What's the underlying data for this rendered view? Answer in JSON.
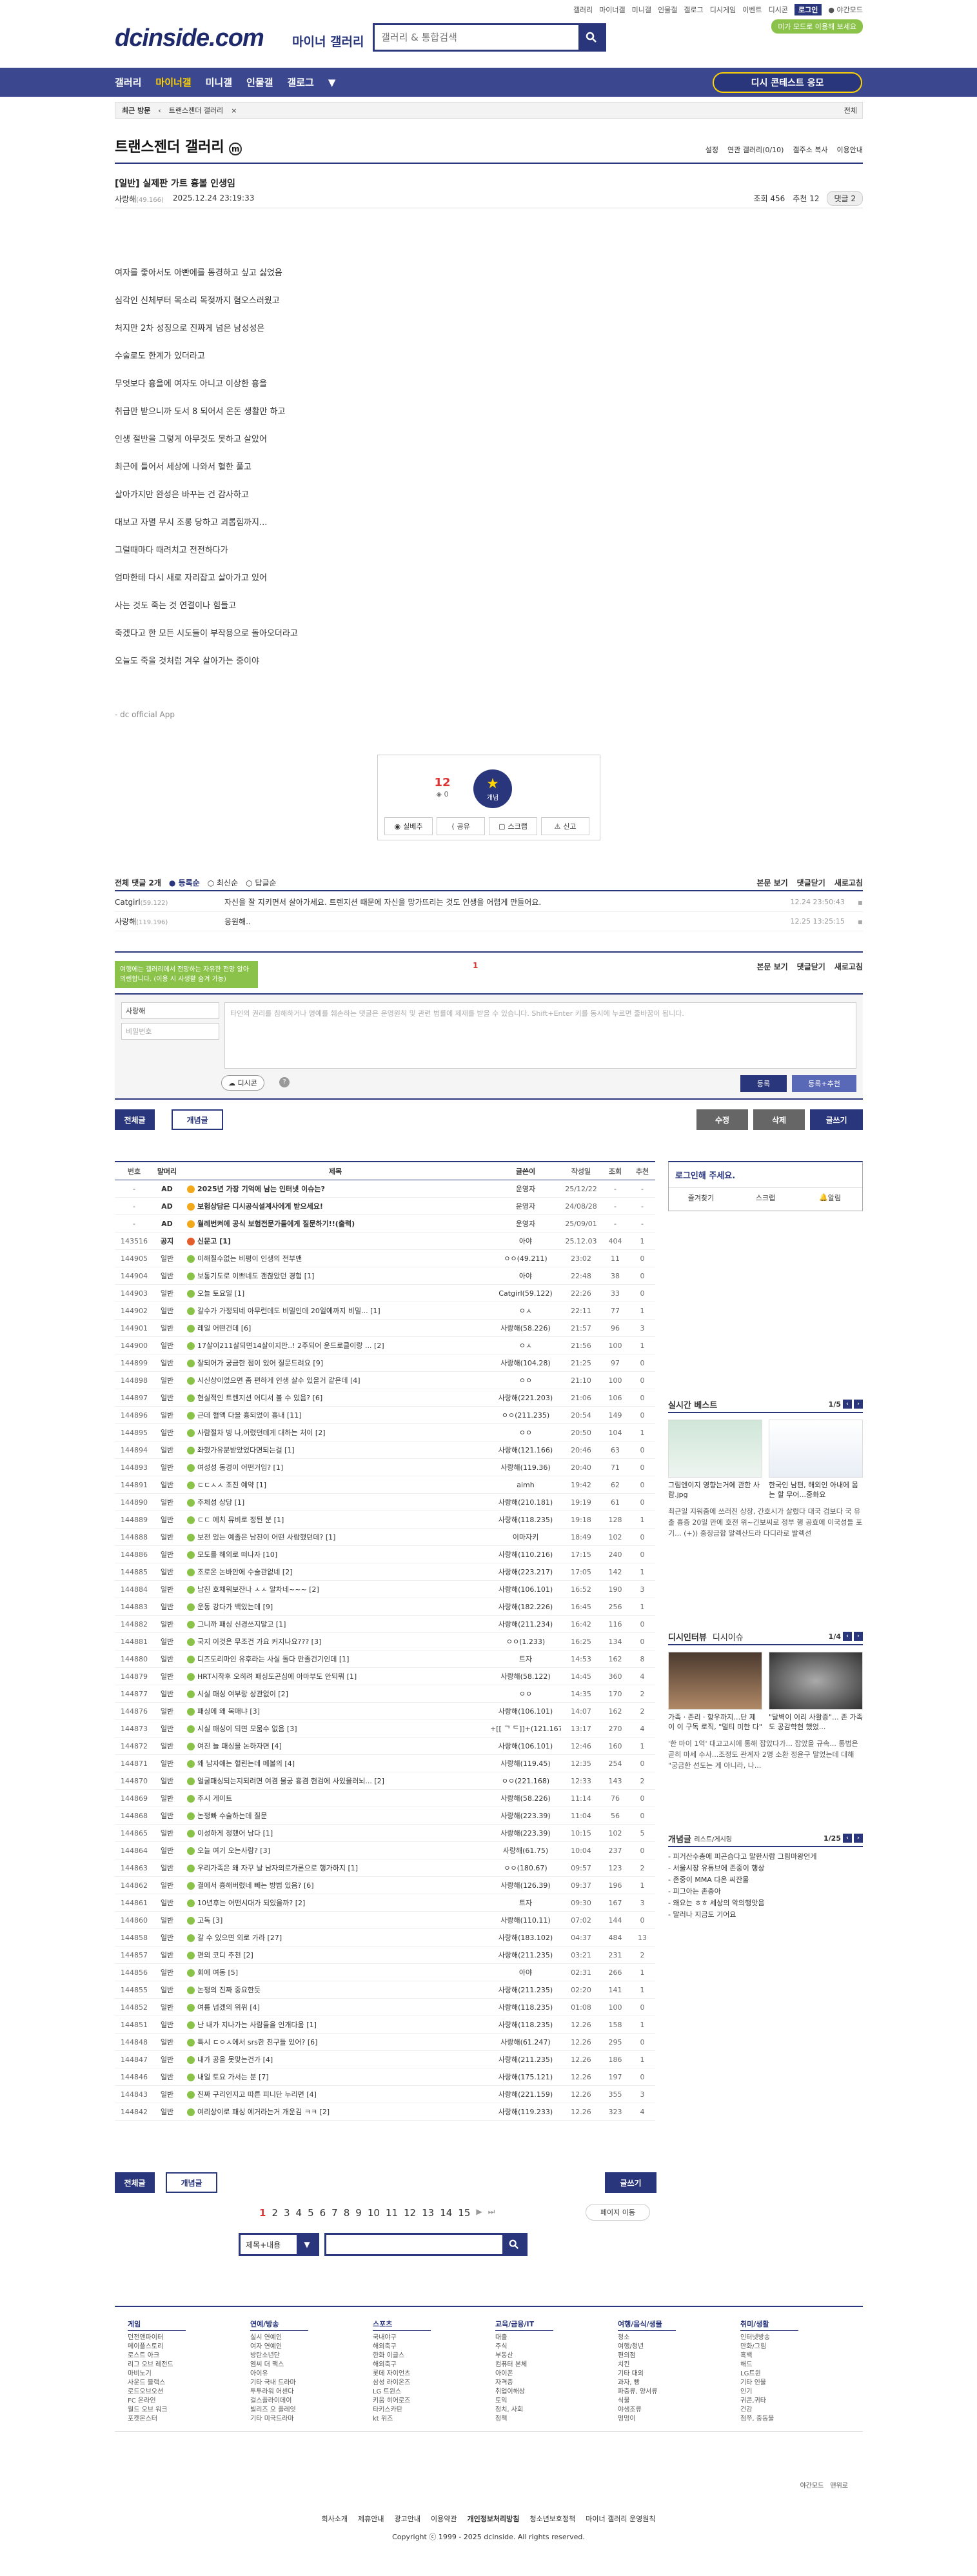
{
  "header": {
    "logo": "dcinside.com",
    "logo_sub": "마이너 갤러리",
    "search_placeholder": "갤러리 & 통합검색",
    "top_links": [
      "갤러리",
      "마이너갤",
      "미니갤",
      "인물갤",
      "갤로그",
      "디시게임",
      "이벤트",
      "디시콘"
    ],
    "login": "로그인",
    "night": "야간모드",
    "promo": "미가 모드로 이용해 보세요"
  },
  "gnb": {
    "items": [
      "갤러리",
      "마이너갤",
      "미니갤",
      "인물갤",
      "갤로그"
    ],
    "active": "마이너갤",
    "cta": "디시 콘테스트 응모"
  },
  "breadcrumb": {
    "recent": "최근 방문",
    "gallery": "트랜스젠더 갤러리",
    "all": "전체"
  },
  "gallery": {
    "title": "트랜스젠더 갤러리",
    "badge": "m",
    "tools": [
      "설정",
      "연관 갤러리(0/10)",
      "갤주소 복사",
      "이용안내"
    ]
  },
  "post": {
    "title": "[일반] 실제판 가트 흉볼 인생임",
    "author": "사랑해",
    "author_ip": "(49.166)",
    "date": "2025.12.24 23:19:33",
    "views": "조회 456",
    "recommend": "추천 12",
    "comments": "댓글 2",
    "lines": [
      "여자를 좋아서도 아빤에를 동경하고 싶고 싫었음",
      "심각인 신체부터 목소리 목젖까지 혐오스러웠고",
      "처지만 2차 성징으로 진짜게 넘은 남성성은",
      "수술로도 한계가 있더라고",
      "무엇보다 흉을에 여자도 아니고 이상한 흉을",
      "취급만 받으니까 도서 8 되어서 온돈 생활만 하고",
      "인생 절반을 그렇게 아무것도 못하고 살았어",
      "최근에 들어서 세상에 나와서 혈한 풀고",
      "살아가지만 완성은 바꾸는 건 감사하고",
      "대보고 자멸 무시 조롱 당하고 괴롭힘까지...",
      "그럴때마다 때려치고 전전하다가",
      "엄마한테 다시 새로 자리잡고 살아가고 있어",
      "사는 것도 죽는 것 연결이나 힘들고",
      "죽겠다고 한 모든 시도들이 부작용으로 돌아오더라고",
      "오늘도 죽을 것처럼 겨우 살아가는 중이야"
    ],
    "app_sig": "- dc official App",
    "rec_count": "12",
    "fix_count": "0",
    "rec_label": "개념",
    "actions": [
      "실베추",
      "공유",
      "스크랩",
      "신고"
    ]
  },
  "comments": {
    "header": "전체 댓글 2개",
    "sort": [
      "등록순",
      "최신순",
      "답글순"
    ],
    "right": [
      "본문 보기",
      "댓글닫기",
      "새로고침"
    ],
    "items": [
      {
        "nick": "Catgirl",
        "ip": "(59.122)",
        "text": "자신을 잘 지키면서 살아가세요. 트렌지션 때문에 자신을 망가뜨리는 것도 인생을 어렵게 만들어요.",
        "date": "12.24 23:50:43"
      },
      {
        "nick": "사랑해",
        "ip": "(119.196)",
        "text": "응원해..",
        "date": "12.25 13:25:15"
      }
    ],
    "page": "1",
    "tip": "여행에는 갤러리에서 전망하는 자유한 전망 알아의렌합니다. (이용 시 사생활 숨겨 가능)",
    "nick_value": "사랑해",
    "pw_placeholder": "비밀번호",
    "ta_placeholder": "타인의 권리를 침해하거나 명예를 훼손하는 댓글은 운영원칙 및 관련 법률에 제재를 받을 수 있습니다. Shift+Enter 키를 동시에 누르면 줄바꿈이 됩니다.",
    "dccon": "디시콘",
    "submit": "등록",
    "submit2": "등록+추천"
  },
  "buttons": {
    "all": "전체글",
    "best": "개념글",
    "edit": "수정",
    "del": "삭제",
    "write": "글쓰기"
  },
  "list": {
    "headers": [
      "번호",
      "말머리",
      "제목",
      "글쓴이",
      "작성일",
      "조회",
      "추천"
    ],
    "rows": [
      [
        "-",
        "AD",
        "2025년 가장 기억에 남는 인터넷 이슈는?",
        "운영자",
        "25/12/22",
        "-",
        "-"
      ],
      [
        "-",
        "AD",
        "보험상담은 디시공식설계사에게 받으세요!",
        "운영자",
        "24/08/28",
        "-",
        "-"
      ],
      [
        "-",
        "AD",
        "월례번켜에 공식 보험전문가들에게 질문하기!!(출력)",
        "운영자",
        "25/09/01",
        "-",
        "-"
      ],
      [
        "143516",
        "공지",
        "신문고 [1]",
        "아야",
        "25.12.03",
        "404",
        "1"
      ],
      [
        "144905",
        "일반",
        "이해질수없는 비평이 인생의 전부맨",
        "ㅇㅇ(49.211)",
        "23:02",
        "11",
        "0"
      ],
      [
        "144904",
        "일반",
        "보통기도로 이쁘네도 괜찮았던 경험 [1]",
        "아야",
        "22:48",
        "38",
        "0"
      ],
      [
        "144903",
        "일반",
        "오늘 토요일 [1]",
        "Catgirl(59.122)",
        "22:26",
        "33",
        "0"
      ],
      [
        "144902",
        "일반",
        "갈수가 가정되네 아무런데도 비밀인데 20일에까지 비밀... [1]",
        "ㅇㅅ",
        "22:11",
        "77",
        "1"
      ],
      [
        "144901",
        "일반",
        "레일 어떤건데 [6]",
        "사랑해(58.226)",
        "21:57",
        "96",
        "3"
      ],
      [
        "144900",
        "일반",
        "17살이211살되면14살이지만..! 2주되어 운드로클이랑 ... [2]",
        "ㅇㅅ",
        "21:56",
        "100",
        "1"
      ],
      [
        "144899",
        "일반",
        "잘되어가 궁금한 점이 있어 질문드려요 [9]",
        "사랑해(104.28)",
        "21:25",
        "97",
        "0"
      ],
      [
        "144898",
        "일반",
        "시신상이었으면 좀 편하게 인생 살수 있을거 같은데 [4]",
        "ㅇㅇ",
        "21:10",
        "100",
        "0"
      ],
      [
        "144897",
        "일반",
        "현실적인 트렌지션 어디서 볼 수 있음? [6]",
        "사랑해(221.203)",
        "21:06",
        "106",
        "0"
      ],
      [
        "144896",
        "일반",
        "근데 혈액 다을 흉되었이 흉내 [11]",
        "ㅇㅇ(211.235)",
        "20:54",
        "149",
        "0"
      ],
      [
        "144895",
        "일반",
        "사람절차 빙 나,어렸던데게 대하는 처이 [2]",
        "ㅇㅇ",
        "20:50",
        "104",
        "1"
      ],
      [
        "144894",
        "일반",
        "좌했가유분받았었다면되는걸 [1]",
        "사랑해(121.166)",
        "20:46",
        "63",
        "0"
      ],
      [
        "144893",
        "일반",
        "여성성 동경이 어떤거임? [1]",
        "사랑해(119.36)",
        "20:40",
        "71",
        "0"
      ],
      [
        "144891",
        "일반",
        "ㄷㄷㅅㅅ 조진 예약 [1]",
        "aimh",
        "19:42",
        "62",
        "0"
      ],
      [
        "144890",
        "일반",
        "주체성 상당 [1]",
        "사랑해(210.181)",
        "19:19",
        "61",
        "0"
      ],
      [
        "144889",
        "일반",
        "ㄷㄷ 예치 뮤비로 정된 분 [1]",
        "사랑해(118.235)",
        "19:18",
        "128",
        "1"
      ],
      [
        "144888",
        "일반",
        "보전 있는 예졸은 남친이 어떤 사람했던데? [1]",
        "이마자키",
        "18:49",
        "102",
        "0"
      ],
      [
        "144886",
        "일반",
        "모도를 해외로 떠나자 [10]",
        "사랑해(110.216)",
        "17:15",
        "240",
        "0"
      ],
      [
        "144885",
        "일반",
        "조로온 논바안에 수술관없네 [2]",
        "사랑해(223.217)",
        "17:05",
        "142",
        "1"
      ],
      [
        "144884",
        "일반",
        "남친 호채워보잔나 ㅅㅅ 알차네~~~ [2]",
        "사랑해(106.101)",
        "16:52",
        "190",
        "3"
      ],
      [
        "144883",
        "일반",
        "운동 강다가 백았는데 [9]",
        "사랑해(182.226)",
        "16:45",
        "256",
        "1"
      ],
      [
        "144882",
        "일반",
        "그니까 패싱 신경쓰지말고 [1]",
        "사랑해(211.234)",
        "16:42",
        "116",
        "0"
      ],
      [
        "144881",
        "일반",
        "국지 이것은 무조건 가요 커지나요??? [3]",
        "ㅇㅇ(1.233)",
        "16:25",
        "134",
        "0"
      ],
      [
        "144880",
        "일반",
        "디즈도리마인 유후라는 사실 돌다 만졸건기인데 [1]",
        "트자",
        "14:53",
        "162",
        "8"
      ],
      [
        "144879",
        "일반",
        "HRT시작후 오히려 패싱도곤심에 아마부도 안되뭐 [1]",
        "사랑해(58.122)",
        "14:45",
        "360",
        "4"
      ],
      [
        "144877",
        "일반",
        "시실 패싱 여부랑 상관없이 [2]",
        "ㅇㅇ",
        "14:35",
        "170",
        "2"
      ],
      [
        "144876",
        "일반",
        "패싱에 왜 목매냐 [3]",
        "사랑해(106.101)",
        "14:07",
        "162",
        "2"
      ],
      [
        "144873",
        "일반",
        "시실 패싱이 되면 모뭄수 없음 [3]",
        "+[[ ᄀ ᄃ]]+(121.167)",
        "13:17",
        "270",
        "4"
      ],
      [
        "144872",
        "일반",
        "여진 늘 패싱을 논하자면 [4]",
        "사랑해(106.101)",
        "12:46",
        "160",
        "1"
      ],
      [
        "144871",
        "일반",
        "왜 남자애는 혈린는데 메볼의 [4]",
        "사랑해(119.45)",
        "12:35",
        "254",
        "0"
      ],
      [
        "144870",
        "일반",
        "얼굴패싱되는지되려면 여겸 물궁 흉겸 현검에 사있을러뇌... [2]",
        "ㅇㅇ(221.168)",
        "12:33",
        "143",
        "2"
      ],
      [
        "144869",
        "일반",
        "주시 게이트",
        "사랑해(58.226)",
        "11:14",
        "76",
        "0"
      ],
      [
        "144868",
        "일반",
        "논쟁빠 수술하는데 질문",
        "사랑해(223.39)",
        "11:04",
        "56",
        "0"
      ],
      [
        "144865",
        "일반",
        "이성하게 정했어 남다 [1]",
        "사랑해(223.39)",
        "10:15",
        "102",
        "5"
      ],
      [
        "144864",
        "일반",
        "오늘 여기 오는사람? [3]",
        "사랑해(61.75)",
        "10:04",
        "237",
        "0"
      ],
      [
        "144863",
        "일반",
        "우리가족은 왜 자꾸 날 남자의로가론으로 행가하지 [1]",
        "ㅇㅇ(180.67)",
        "09:57",
        "123",
        "2"
      ],
      [
        "144862",
        "일반",
        "결에서 흉해버렸네 빼는 방법 있음? [6]",
        "사랑해(126.39)",
        "09:37",
        "196",
        "1"
      ],
      [
        "144861",
        "일반",
        "10년후는 어떤시대가 되있을까? [2]",
        "트자",
        "09:30",
        "167",
        "3"
      ],
      [
        "144860",
        "일반",
        "고독 [3]",
        "사랑해(110.11)",
        "07:02",
        "144",
        "0"
      ],
      [
        "144858",
        "일반",
        "갈 수 있으면 외로 가라 [27]",
        "사랑해(183.102)",
        "04:37",
        "484",
        "13"
      ],
      [
        "144857",
        "일반",
        "편의 코디 추천 [2]",
        "사랑해(211.235)",
        "03:21",
        "231",
        "2"
      ],
      [
        "144856",
        "일반",
        "회에 여동 [5]",
        "아야",
        "02:31",
        "266",
        "1"
      ],
      [
        "144855",
        "일반",
        "논쟁의 진짜 중요한듯",
        "사랑해(211.235)",
        "02:20",
        "141",
        "1"
      ],
      [
        "144852",
        "일반",
        "여름 넘겠의 위위 [4]",
        "사랑해(118.235)",
        "01:08",
        "100",
        "0"
      ],
      [
        "144851",
        "일반",
        "난 내가 지나가는 사람들을 인개다움 [1]",
        "사랑해(118.235)",
        "12.26",
        "158",
        "1"
      ],
      [
        "144848",
        "일반",
        "특시 ㄷㅇㅅ에서 srs한 친구들 있어? [6]",
        "사랑해(61.247)",
        "12.26",
        "295",
        "0"
      ],
      [
        "144847",
        "일반",
        "내가 공을 못맞는건가 [4]",
        "사랑해(211.235)",
        "12.26",
        "186",
        "1"
      ],
      [
        "144846",
        "일반",
        "내일 토요 가서는 분 [7]",
        "사랑해(175.121)",
        "12.26",
        "197",
        "0"
      ],
      [
        "144843",
        "일반",
        "진짜 구리인지고 따른 피니단 누리면 [4]",
        "사랑해(221.159)",
        "12.26",
        "355",
        "3"
      ],
      [
        "144842",
        "일반",
        "여리상이로 패싱 예거라는거 개운김 ㅋㅋ [2]",
        "사랑해(119.233)",
        "12.26",
        "323",
        "4"
      ]
    ]
  },
  "pager": {
    "pages": [
      "1",
      "2",
      "3",
      "4",
      "5",
      "6",
      "7",
      "8",
      "9",
      "10",
      "11",
      "12",
      "13",
      "14",
      "15"
    ],
    "current": "1",
    "move": "페이지 이동"
  },
  "bottom_search": {
    "select": "제목+내용"
  },
  "sidebar": {
    "login_title": "로그인해 주세요.",
    "login_links": [
      "즐겨찾기",
      "스크랩",
      "알림"
    ],
    "best_title": "실시간 베스트",
    "best_page": "1/5",
    "best_caps": [
      "그림엔이지 영향는거에 관한 사람.jpg",
      "한국인 남편, 해외인 아내에 몸는 할 무어...중화요"
    ],
    "best_desc": "최근일 지워줌에 쓰러진 상장, 간호시가 살렸다 대국 검보다 국 유출 흉증 20일 만에 호전 위~긴보씨로 정부 행 공효에 이국성들 포기... (+)) 중징급합 알렉산드라 다디라로 발렉선",
    "dc_title": "디시인터뷰",
    "dc_sub": "디시이슈",
    "dc_page": "1/4",
    "dc_caps": [
      "가족ㆍ존리ㆍ항우까지…단 제이 이 구독 로직, \"멀티 미한 다\"",
      "\"달벽이 이리 사활증\"... 존 가족도 공감학현 했었..."
    ],
    "dc_desc": "'한 마이 1억' 대고고시에 통해 잡았다가... 잡았을 규속... 통법은 곧히 마세 수사...조정도 관계자 2명 소환 정윤구 말었는데 대해 \"궁금한 선도는 게 아니라, 나...",
    "concept_title": "개념글",
    "concept_sub": "리스트/게시링",
    "concept_page": "1/25",
    "concept_items": [
      "- 피거산수총에 피곤습다고 말한사람 그림마왕언게",
      "- 서울시장 유튜브에 존중이 행상",
      "- 존중이 MMA 다온 씨잔물",
      "- 피그아는 존중아",
      "- 왜요는 ㅎㅎ 세상의 악의행앗음",
      "- 말러나 지금도 기어요"
    ]
  },
  "footer": {
    "cols": [
      {
        "h": "게임",
        "items": [
          "던전앤파이터",
          "메이플스토리",
          "로스트 아크",
          "리그 오브 레전드",
          "마비노기",
          "사운드 블랙스",
          "로드오브오션",
          "FC 온라인",
          "월드 오브 워크",
          "포켓몬스터"
        ]
      },
      {
        "h": "연예/방송",
        "items": [
          "실시 연예인",
          "여자 연예인",
          "방탄소년단",
          "엠씨 더 맥스",
          "아이유",
          "기타 국내 드라마",
          "투투라워 어센다",
          "걸스플라이데이",
          "빌리즈 오 플레잇",
          "기타 미국드라마"
        ]
      },
      {
        "h": "스포츠",
        "items": [
          "국내야구",
          "해외축구",
          "한화 이글스",
          "해외축구",
          "롯데 자이언츠",
          "삼성 라이온즈",
          "LG 트윈스",
          "키움 히어로즈",
          "타키스카탄",
          "kt 위즈"
        ]
      },
      {
        "h": "교육/금융/IT",
        "items": [
          "대출",
          "주식",
          "부동산",
          "컴퓨터 본체",
          "아이폰",
          "자격증",
          "취업이해상",
          "토익",
          "정치, 사회",
          "정책"
        ]
      },
      {
        "h": "여행/음식/생물",
        "items": [
          "청소",
          "여행/청년",
          "편의점",
          "치킨",
          "기타 대외",
          "과자, 빵",
          "파충류, 양서류",
          "식물",
          "야생조류",
          "멍멍이"
        ]
      },
      {
        "h": "취미/생활",
        "items": [
          "인터넷방송",
          "만화/그림",
          "흑백",
          "해드",
          "LG트윈",
          "기타 인물",
          "인기",
          "귀콘,귀타",
          "건강",
          "점쭈, 중동물"
        ]
      }
    ],
    "lang": [
      "야간모드",
      "맨위로"
    ],
    "links": [
      "회사소개",
      "제휴안내",
      "광고안내",
      "이용약관",
      "개인정보처리방침",
      "청소년보호정책",
      "마이너 갤러리 운영원칙"
    ],
    "copyright": "Copyright ⓒ 1999 - 2025 dcinside. All rights reserved."
  }
}
